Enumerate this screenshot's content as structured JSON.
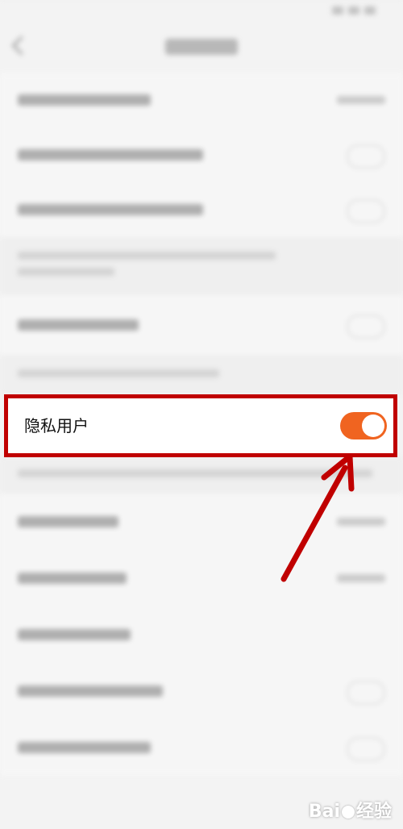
{
  "privacy_row": {
    "label": "隐私用户",
    "toggle_state": "on",
    "toggle_color": "#f06420"
  },
  "annotation": {
    "box_color": "#c00000",
    "arrow_color": "#c00000"
  },
  "watermark": {
    "text_a": "Bai",
    "text_b": "经验"
  },
  "icons": [
    "back-icon",
    "chevron-icon",
    "toggle-icon"
  ]
}
